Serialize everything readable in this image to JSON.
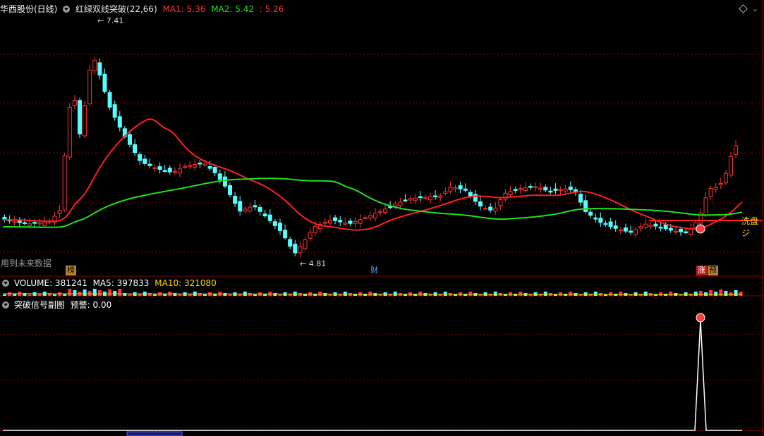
{
  "main_header": {
    "stock_name": "华西股份(日线)",
    "indicator_name": "红绿双线突破(22,66)",
    "ma1_label": "MA1: 5.36",
    "ma2_label": "MA2: 5.42",
    "extra_value": ": 5.26"
  },
  "price_annotations": {
    "high": "7.41",
    "low": "4.81"
  },
  "future_data_note": "用到未来数据",
  "side_label": "洗盘ジ",
  "event_badges": {
    "bang": "榜",
    "cai": "财",
    "zhang": "涨",
    "yu": "预"
  },
  "volume_header": {
    "volume": "VOLUME: 381241",
    "ma5": "MA5: 397833",
    "ma10": "MA10: 321080"
  },
  "sub_header": {
    "title": "突破信号副图",
    "alert": "预警: 0.00"
  },
  "colors": {
    "up": "#ff3232",
    "down": "#54ffff",
    "ma1": "#ff2020",
    "ma2": "#20e020",
    "grid": "#8b0000",
    "header_red": "#ff3232",
    "header_green": "#20e020",
    "vol_ma10": "#ffd700",
    "signal_line": "#ffffff"
  },
  "icons": {
    "settings": "diamond-icon",
    "dropdown": "circle-dropdown-icon",
    "signal": "red-ball-icon"
  }
}
